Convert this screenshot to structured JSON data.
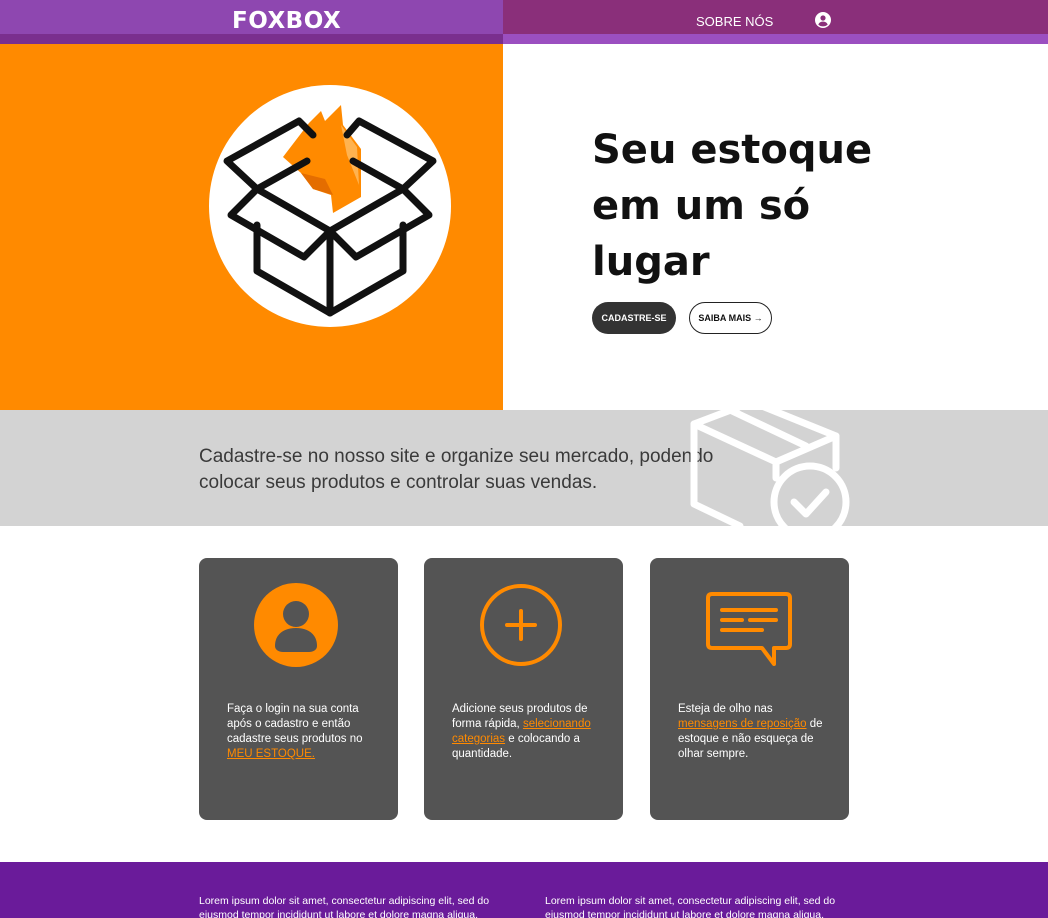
{
  "header": {
    "brand": "FOXBOX",
    "nav_about": "SOBRE NÓS",
    "user_icon": "user-circle-icon"
  },
  "hero": {
    "title": "Seu estoque em um só lugar",
    "signup_label": "CADASTRE-SE",
    "more_label": "SAIBA MAIS →",
    "logo_icon": "fox-box-logo-icon"
  },
  "band": {
    "text": "Cadastre-se no nosso site e organize seu mercado, podendo colocar seus produtos e controlar suas vendas.",
    "icon": "box-check-icon"
  },
  "cards": [
    {
      "icon": "user-icon",
      "text_before": "Faça o login na sua conta após o cadastro e então cadastre seus produtos no ",
      "link": "MEU ESTOQUE.",
      "text_after": ""
    },
    {
      "icon": "plus-circle-icon",
      "text_before": "Adicione seus produtos de forma rápida, ",
      "link": "selecionando categorias",
      "text_after": " e colocando a quantidade."
    },
    {
      "icon": "message-icon",
      "text_before": "Esteja de olho nas ",
      "link": "mensagens de reposição",
      "text_after": " de estoque e não esqueça de olhar sempre."
    }
  ],
  "footer": {
    "col1": "Lorem ipsum dolor sit amet, consectetur adipiscing elit, sed do eiusmod tempor incididunt ut labore et dolore magna aliqua.",
    "col2": "Lorem ipsum dolor sit amet, consectetur adipiscing elit, sed do eiusmod tempor incididunt ut labore et dolore magna aliqua."
  },
  "colors": {
    "orange": "#ff8a00",
    "purple": "#6a1b9a",
    "dark_card": "#545454",
    "band_gray": "#d3d3d3"
  }
}
